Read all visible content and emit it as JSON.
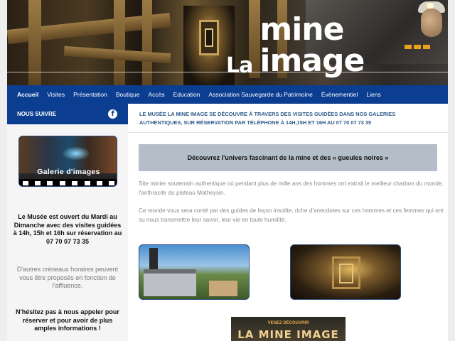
{
  "logo": {
    "prefix": "La",
    "name": "mine image"
  },
  "nav": {
    "items": [
      "Accueil",
      "Visites",
      "Présentation",
      "Boutique",
      "Accès",
      "Education",
      "Association Sauvegarde du Patrimoine",
      "Évènementiel",
      "Liens"
    ],
    "active": "Accueil",
    "color": "#0b3d91"
  },
  "sidebar": {
    "follow_label": "NOUS SUIVRE",
    "social_icon": "facebook-icon",
    "gallery_label": "Galerie d'images",
    "hours_text": "Le Musée est ouvert du Mardi au Dimanche avec des visites guidées à 14h, 15h et 16h sur réservation au 07 70 07 73 35",
    "other_slots_text": "D'autres créneaux horaires peuvent vous être proposés en fonction de l'affluence.",
    "call_text": "N'hésitez pas à nous appeler pour réserver et pour avoir de plus amples informations !"
  },
  "main": {
    "intro": "Le Musée La Mine Image se découvre à travers des visites guidées dans nos galeries authentiques, sur réservation par téléphone à 14h,15h et 16h au 07 70 07 73 35",
    "highlight": "Découvrez l'univers fascinant de la mine et des « gueules noires »",
    "para1": "Site minier souterrain authentique où pendant plus de mille ans des hommes ont extrait le meilleur charbon du monde, l'anthracite du plateau Matheysin.",
    "para2": "Ce monde vous sera conté par des guides de façon insolite, riche d'anecdotes sur ces hommes et ces femmes qui ont su nous transmettre leur savoir, leur vie en toute humilité.",
    "poster_sub": "VENEZ DÉCOUVRIR",
    "poster_title": "LA MINE IMAGE"
  }
}
